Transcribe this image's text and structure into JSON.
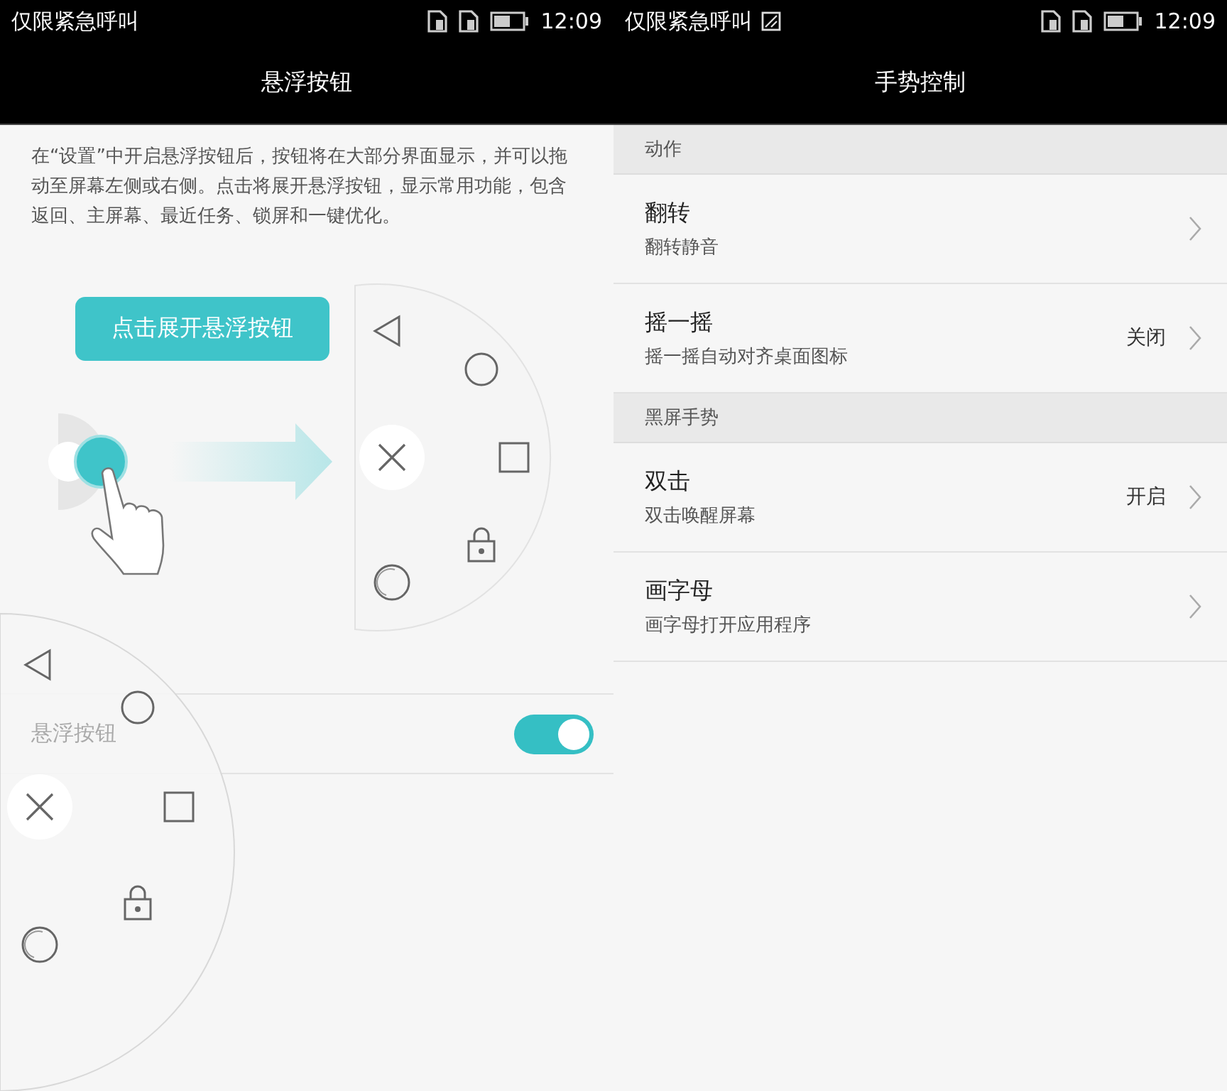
{
  "left_screen": {
    "status_bar": {
      "carrier": "仅限紧急呼叫",
      "time": "12:09"
    },
    "title": "悬浮按钮",
    "description": "在“设置”中开启悬浮按钮后，按钮将在大部分界面显示，并可以拖动至屏幕左侧或右侧。点击将展开悬浮按钮，显示常用功能，包含返回、主屏幕、最近任务、锁屏和一键优化。",
    "illustration": {
      "button_label": "点击展开悬浮按钮"
    },
    "setting": {
      "label": "悬浮按钮",
      "on": true
    }
  },
  "right_screen": {
    "status_bar": {
      "carrier": "仅限紧急呼叫",
      "time": "12:09"
    },
    "title": "手势控制",
    "sections": [
      {
        "header": "动作",
        "items": [
          {
            "title": "翻转",
            "subtitle": "翻转静音"
          },
          {
            "title": "摇一摇",
            "subtitle": "摇一摇自动对齐桌面图标",
            "value": "关闭"
          }
        ]
      },
      {
        "header": "黑屏手势",
        "items": [
          {
            "title": "双击",
            "subtitle": "双击唤醒屏幕",
            "value": "开启"
          },
          {
            "title": "画字母",
            "subtitle": "画字母打开应用程序"
          }
        ]
      }
    ]
  }
}
